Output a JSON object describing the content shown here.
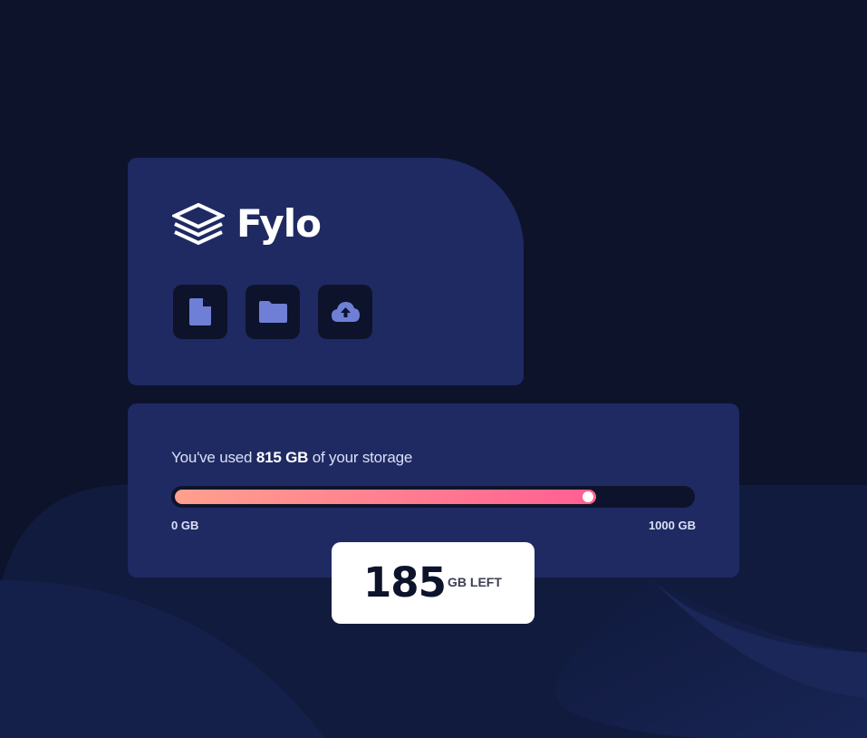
{
  "brand": {
    "name": "Fylo",
    "logo_icon": "stacked-layers-icon"
  },
  "tools": [
    {
      "icon": "document-icon",
      "label": "document"
    },
    {
      "icon": "folder-icon",
      "label": "folder"
    },
    {
      "icon": "cloud-upload-icon",
      "label": "upload"
    }
  ],
  "storage": {
    "used_prefix": "You've used ",
    "used_amount": "815 GB",
    "used_suffix": " of your storage",
    "used_fraction": 0.815,
    "scale_min": "0 GB",
    "scale_max": "1000 GB"
  },
  "remaining": {
    "value": "185",
    "unit": "GB LEFT"
  },
  "colors": {
    "background": "#0d132b",
    "card": "#1f2a63",
    "accent_icon": "#6f7fd6",
    "gradient_start": "#ffa08d",
    "gradient_end": "#ff5f92"
  }
}
